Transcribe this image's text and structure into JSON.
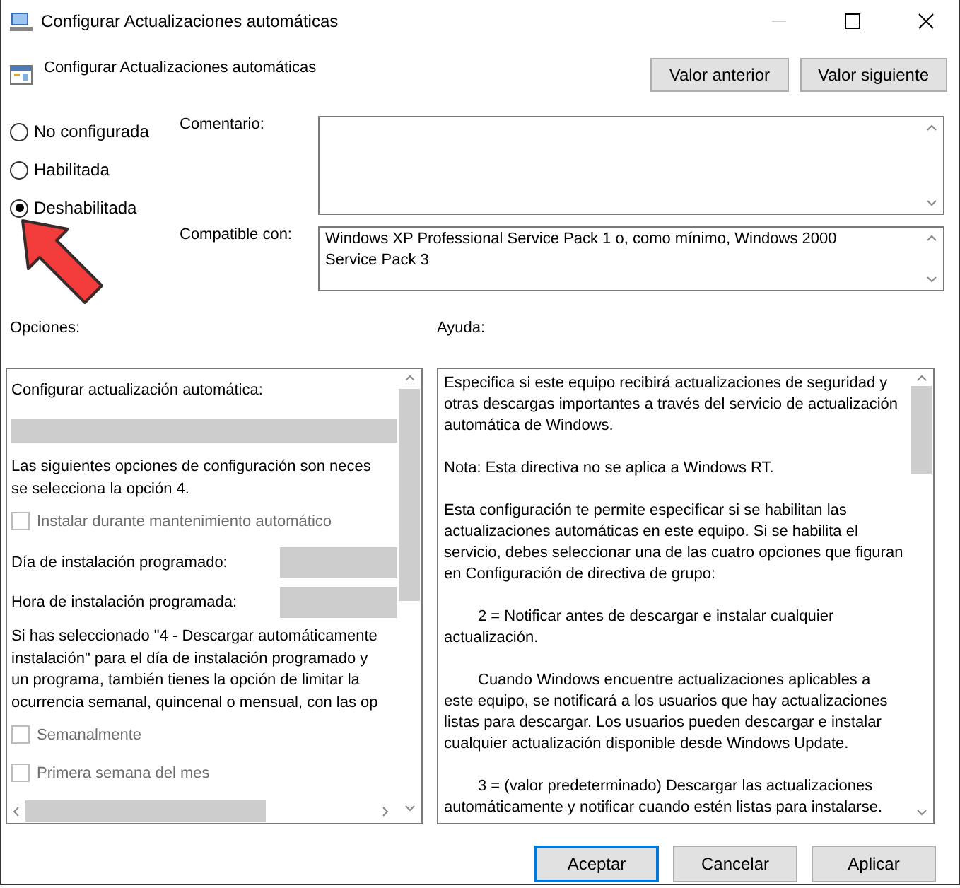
{
  "window": {
    "title": "Configurar Actualizaciones automáticas"
  },
  "policy": {
    "name": "Configurar Actualizaciones automáticas"
  },
  "nav_buttons": [
    "Valor anterior",
    "Valor siguiente"
  ],
  "states": [
    {
      "label": "No configurada",
      "selected": false
    },
    {
      "label": "Habilitada",
      "selected": false
    },
    {
      "label": "Deshabilitada",
      "selected": true
    }
  ],
  "comment": {
    "label": "Comentario:"
  },
  "compatible": {
    "label": "Compatible con:",
    "lines": [
      "Windows XP Professional Service Pack 1 o, como mínimo, Windows 2000",
      "Service Pack 3"
    ]
  },
  "options": {
    "label": "Opciones:",
    "items": [
      {
        "kind": "label",
        "text": "Configurar actualización automática:"
      },
      {
        "kind": "dropdown"
      },
      {
        "kind": "text",
        "lines": [
          "Las siguientes opciones de configuración son neces",
          "se selecciona la opción 4."
        ]
      },
      {
        "kind": "checkbox",
        "text": "Instalar durante mantenimiento automático",
        "checked": false,
        "disabled": true
      },
      {
        "kind": "field",
        "text": "Día de instalación programado:"
      },
      {
        "kind": "field",
        "text": "Hora de instalación programada:"
      },
      {
        "kind": "text",
        "lines": [
          "Si has seleccionado \"4 - Descargar automáticamente",
          "instalación\" para el día de instalación programado y",
          "un programa, también tienes la opción de limitar la",
          "ocurrencia semanal, quincenal o mensual, con las op"
        ]
      },
      {
        "kind": "checkbox",
        "text": "Semanalmente",
        "checked": false,
        "disabled": true
      },
      {
        "kind": "checkbox",
        "text": "Primera semana del mes",
        "checked": false,
        "disabled": true
      }
    ]
  },
  "help": {
    "label": "Ayuda:",
    "paragraphs": [
      {
        "text": "Especifica si este equipo recibirá actualizaciones de seguridad y otras descargas importantes a través del servicio de actualización automática de Windows.",
        "indent": false
      },
      {
        "text": "Nota: Esta directiva no se aplica a Windows RT.",
        "indent": false
      },
      {
        "text": "Esta configuración te permite especificar si se habilitan las actualizaciones automáticas en este equipo. Si se habilita el servicio, debes seleccionar una de las cuatro opciones que figuran en Configuración de directiva de grupo:",
        "indent": false
      },
      {
        "text": "2 = Notificar antes de descargar e instalar cualquier actualización.",
        "indent": true
      },
      {
        "text": "Cuando Windows encuentre actualizaciones aplicables a este equipo, se notificará a los usuarios que hay actualizaciones listas para descargar. Los usuarios pueden descargar e instalar cualquier actualización disponible desde Windows Update.",
        "indent": true
      },
      {
        "text": "3 = (valor predeterminado) Descargar las actualizaciones automáticamente y notificar cuando estén listas para instalarse.",
        "indent": true
      }
    ]
  },
  "footer_buttons": [
    {
      "label": "Aceptar",
      "default": true
    },
    {
      "label": "Cancelar",
      "default": false
    },
    {
      "label": "Aplicar",
      "default": false
    }
  ]
}
